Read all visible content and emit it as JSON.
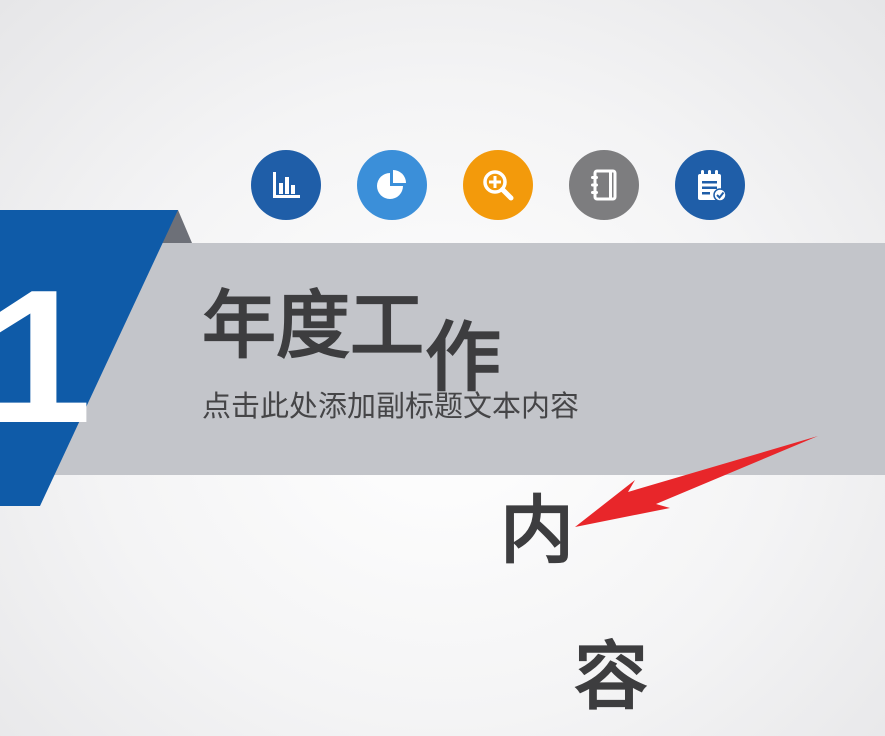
{
  "slide": {
    "section_number": "1",
    "title_chars": [
      "年",
      "度",
      "工",
      "作",
      "内",
      "容"
    ],
    "subtitle": "点击此处添加副标题文本内容"
  },
  "icons": [
    {
      "name": "bar-chart-icon",
      "color": "#1f5ea8"
    },
    {
      "name": "pie-chart-icon",
      "color": "#3b8fd9"
    },
    {
      "name": "zoom-in-icon",
      "color": "#f39a0b"
    },
    {
      "name": "notebook-icon",
      "color": "#7d7d7f"
    },
    {
      "name": "notepad-check-icon",
      "color": "#1f5ea8"
    }
  ],
  "colors": {
    "accent_blue": "#0f5ba8",
    "band_gray": "#c3c5ca",
    "title_text": "#3d3d3f",
    "arrow_red": "#e8262a"
  }
}
